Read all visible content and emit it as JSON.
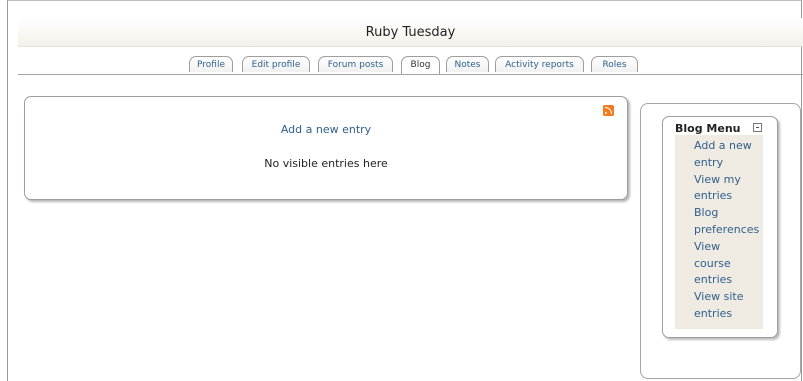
{
  "header": {
    "title": "Ruby Tuesday"
  },
  "tabs": [
    {
      "label": "Profile",
      "active": false
    },
    {
      "label": "Edit profile",
      "active": false
    },
    {
      "label": "Forum posts",
      "active": false
    },
    {
      "label": "Blog",
      "active": true
    },
    {
      "label": "Notes",
      "active": false
    },
    {
      "label": "Activity reports",
      "active": false
    },
    {
      "label": "Roles",
      "active": false
    }
  ],
  "main": {
    "add_entry_label": "Add a new entry",
    "empty_message": "No visible entries here",
    "rss_icon": "rss-feed-icon"
  },
  "sidebar": {
    "title": "Blog Menu",
    "collapse_icon": "collapse-icon",
    "menu_lines": [
      "Add a new",
      "entry",
      "View my",
      "entries",
      "Blog",
      "preferences",
      "View",
      "course",
      "entries",
      "View site",
      "entries"
    ]
  }
}
